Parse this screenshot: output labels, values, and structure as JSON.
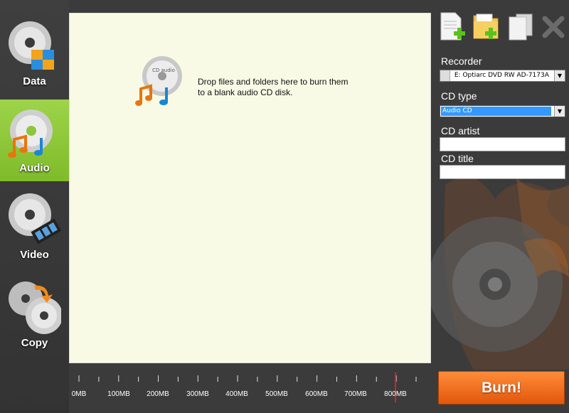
{
  "sidebar": {
    "items": [
      {
        "label": "Data",
        "icon": "data-disc-icon",
        "active": false
      },
      {
        "label": "Audio",
        "icon": "audio-disc-icon",
        "active": true
      },
      {
        "label": "Video",
        "icon": "video-disc-icon",
        "active": false
      },
      {
        "label": "Copy",
        "icon": "copy-disc-icon",
        "active": false
      }
    ]
  },
  "drop_area": {
    "message_line1": "Drop files and folders here to burn them",
    "message_line2": "to a blank audio CD disk.",
    "icon": "audio-cd-icon",
    "icon_label": "CD audio"
  },
  "ruler": {
    "labels": [
      "0MB",
      "100MB",
      "200MB",
      "300MB",
      "400MB",
      "500MB",
      "600MB",
      "700MB",
      "800MB"
    ],
    "limit_marker_mb": 800,
    "limit_color": "#e02020"
  },
  "toolbar": {
    "buttons": [
      {
        "icon": "add-file-icon"
      },
      {
        "icon": "add-folder-icon"
      },
      {
        "icon": "copy-files-icon"
      },
      {
        "icon": "remove-icon"
      }
    ]
  },
  "recorder": {
    "label": "Recorder",
    "value": "E: Optiarc DVD RW AD-7173A"
  },
  "cd_type": {
    "label": "CD type",
    "value": "Audio CD"
  },
  "cd_artist": {
    "label": "CD artist",
    "value": ""
  },
  "cd_title": {
    "label": "CD title",
    "value": ""
  },
  "burn": {
    "label": "Burn!"
  },
  "colors": {
    "active_tab": "#8cc63f",
    "burn_button": "#f07020",
    "drop_area_bg": "#f9fae6",
    "select_highlight": "#3399ff"
  }
}
